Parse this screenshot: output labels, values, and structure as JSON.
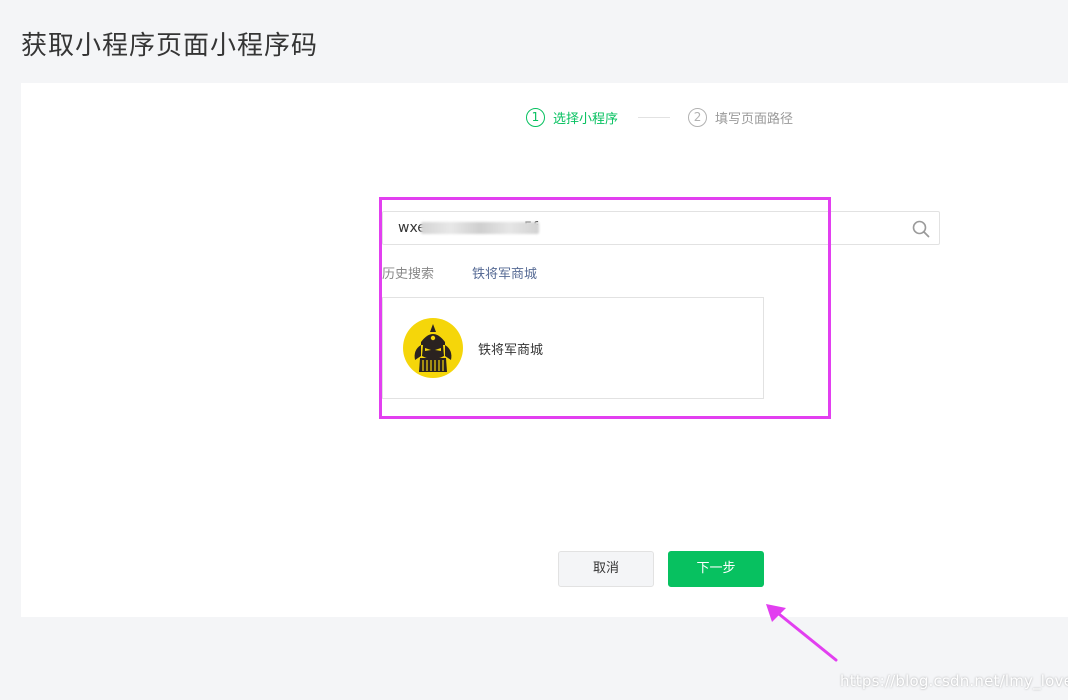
{
  "page": {
    "title": "获取小程序页面小程序码"
  },
  "steps": [
    {
      "num": "1",
      "label": "选择小程序",
      "state": "active"
    },
    {
      "num": "2",
      "label": "填写页面路径",
      "state": "inactive"
    }
  ],
  "search": {
    "value_prefix": "wxe",
    "value_suffix": "5f",
    "icon": "search-icon"
  },
  "history": {
    "label": "历史搜索",
    "items": [
      "铁将军商城"
    ]
  },
  "results": [
    {
      "name": "铁将军商城",
      "avatar_icon": "mascot-avatar"
    }
  ],
  "buttons": {
    "cancel": "取消",
    "next": "下一步"
  },
  "annotation": {
    "color": "#e23ff0"
  },
  "watermark": "https://blog.csdn.net/lmy_loveF",
  "colors": {
    "accent": "#07c160",
    "link": "#576b95",
    "avatar_bg": "#f5d60a"
  }
}
